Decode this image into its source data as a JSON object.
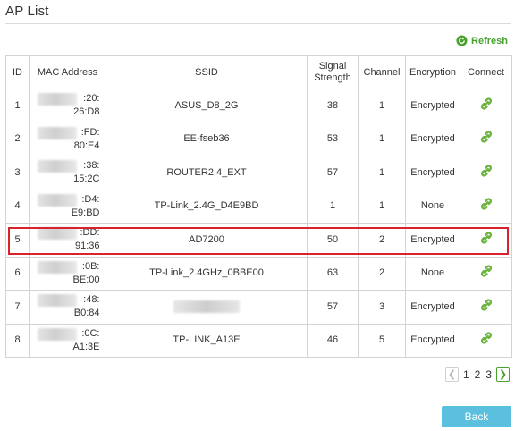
{
  "page": {
    "title": "AP List"
  },
  "toolbar": {
    "refresh_label": "Refresh"
  },
  "table": {
    "headers": {
      "id": "ID",
      "mac": "MAC Address",
      "ssid": "SSID",
      "signal_line1": "Signal",
      "signal_line2": "Strength",
      "channel": "Channel",
      "encryption": "Encryption",
      "connect": "Connect"
    },
    "rows": [
      {
        "id": "1",
        "mac_line1": ":20:",
        "mac_line2": "26:D8",
        "ssid": "ASUS_D8_2G",
        "signal": "38",
        "channel": "1",
        "encryption": "Encrypted"
      },
      {
        "id": "2",
        "mac_line1": ":FD:",
        "mac_line2": "80:E4",
        "ssid": "EE-fseb36",
        "signal": "53",
        "channel": "1",
        "encryption": "Encrypted"
      },
      {
        "id": "3",
        "mac_line1": ":38:",
        "mac_line2": "15:2C",
        "ssid": "ROUTER2.4_EXT",
        "signal": "57",
        "channel": "1",
        "encryption": "Encrypted"
      },
      {
        "id": "4",
        "mac_line1": ":D4:",
        "mac_line2": "E9:BD",
        "ssid": "TP-Link_2.4G_D4E9BD",
        "signal": "1",
        "channel": "1",
        "encryption": "None"
      },
      {
        "id": "5",
        "mac_line1": ":DD:",
        "mac_line2": "91:36",
        "ssid": "AD7200",
        "signal": "50",
        "channel": "2",
        "encryption": "Encrypted"
      },
      {
        "id": "6",
        "mac_line1": ":0B:",
        "mac_line2": "BE:00",
        "ssid": "TP-Link_2.4GHz_0BBE00",
        "signal": "63",
        "channel": "2",
        "encryption": "None"
      },
      {
        "id": "7",
        "mac_line1": ":48:",
        "mac_line2": "B0:84",
        "ssid": "",
        "signal": "57",
        "channel": "3",
        "encryption": "Encrypted"
      },
      {
        "id": "8",
        "mac_line1": ":0C:",
        "mac_line2": "A1:3E",
        "ssid": "TP-LINK_A13E",
        "signal": "46",
        "channel": "5",
        "encryption": "Encrypted"
      }
    ]
  },
  "pagination": {
    "pages": [
      "1",
      "2",
      "3"
    ],
    "prev_glyph": "❮",
    "next_glyph": "❯"
  },
  "footer": {
    "back_label": "Back"
  },
  "colors": {
    "accent_green": "#4aa12f",
    "highlight_red": "#d9232c",
    "button_blue": "#5bc0de"
  }
}
